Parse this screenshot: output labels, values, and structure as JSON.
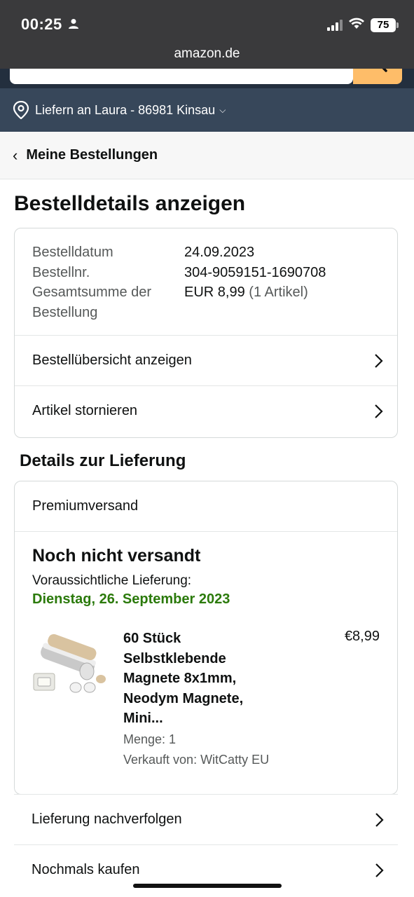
{
  "status_bar": {
    "time": "00:25",
    "battery": "75",
    "url": "amazon.de"
  },
  "deliver": {
    "label": "Liefern an Laura - 86981 Kinsau",
    "chevron": "⌵"
  },
  "breadcrumb": {
    "back_icon": "‹",
    "label": "Meine Bestellungen"
  },
  "page_title": "Bestelldetails anzeigen",
  "order_info": {
    "date_label": "Bestelldatum",
    "date_value": "24.09.2023",
    "number_label": "Bestellnr.",
    "number_value": "304-9059151-1690708",
    "total_label": "Gesamtsumme der Bestellung",
    "total_value": "EUR 8,99",
    "total_items": "(1 Artikel)"
  },
  "order_actions": [
    {
      "label": "Bestellübersicht anzeigen"
    },
    {
      "label": "Artikel stornieren"
    }
  ],
  "delivery_section": {
    "title": "Details zur Lieferung",
    "shipping_type": "Premiumversand",
    "status": "Noch nicht versandt",
    "eta_label": "Voraussichtliche Lieferung:",
    "eta_date": "Dienstag, 26. September 2023",
    "item": {
      "title": "60 Stück Selbstklebende Magnete 8x1mm, Neodym Magnete, Mini...",
      "price": "€8,99",
      "quantity": "Menge: 1",
      "seller": "Verkauft von: WitCatty EU"
    }
  },
  "bottom_actions": [
    {
      "label": "Lieferung nachverfolgen"
    },
    {
      "label": "Nochmals kaufen"
    }
  ],
  "colors": {
    "header_dark": "#232f3e",
    "deliver_bar": "#37475a",
    "search_button": "#febd69",
    "eta_green": "#2b7a0b"
  }
}
